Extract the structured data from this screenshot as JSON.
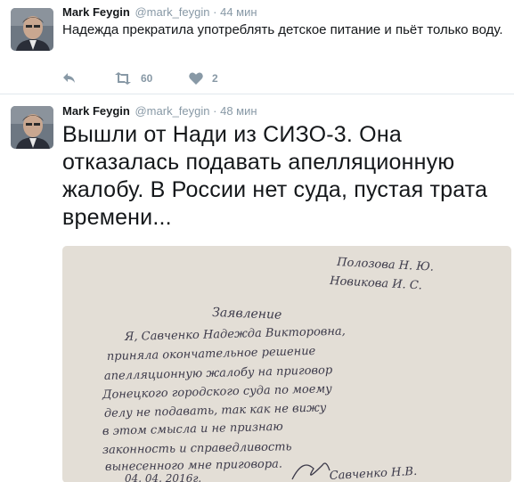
{
  "tweets": [
    {
      "author_name": "Mark Feygin",
      "handle": "@mark_feygin",
      "separator": "·",
      "time": "44 мин",
      "text": "Надежда прекратила употреблять детское питание и пьёт только воду.",
      "retweets": "60",
      "likes": "2",
      "avatar_icon": "avatar-portrait"
    },
    {
      "author_name": "Mark Feygin",
      "handle": "@mark_feygin",
      "separator": "·",
      "time": "48 мин",
      "text": "Вышли от Нади из СИЗО-3. Она отказалась подавать апелляционную жалобу. В России нет суда, пустая трата времени...",
      "avatar_icon": "avatar-portrait"
    }
  ],
  "photo": {
    "addressees": [
      "Полозова Н. Ю.",
      "Новикова И. С."
    ],
    "heading": "Заявление",
    "body_lines": [
      "Я, Савченко Надежда Викторовна,",
      "приняла окончательное решение",
      "апелляционную жалобу на приговор",
      "Донецкого городского суда по моему",
      "делу не подавать, так как не вижу",
      "в этом смысла и не признаю",
      "законность и справедливость",
      "вынесенного мне приговора."
    ],
    "date": "04. 04. 2016г.",
    "signature": "Савченко Н.В."
  },
  "icons": {
    "reply": "reply-icon",
    "retweet": "retweet-icon",
    "like": "heart-icon"
  },
  "colors": {
    "text": "#14171a",
    "muted": "#8899a6",
    "divider": "#e1e8ed",
    "paper": "#e9e4dc",
    "ink": "#3c3a4a"
  }
}
